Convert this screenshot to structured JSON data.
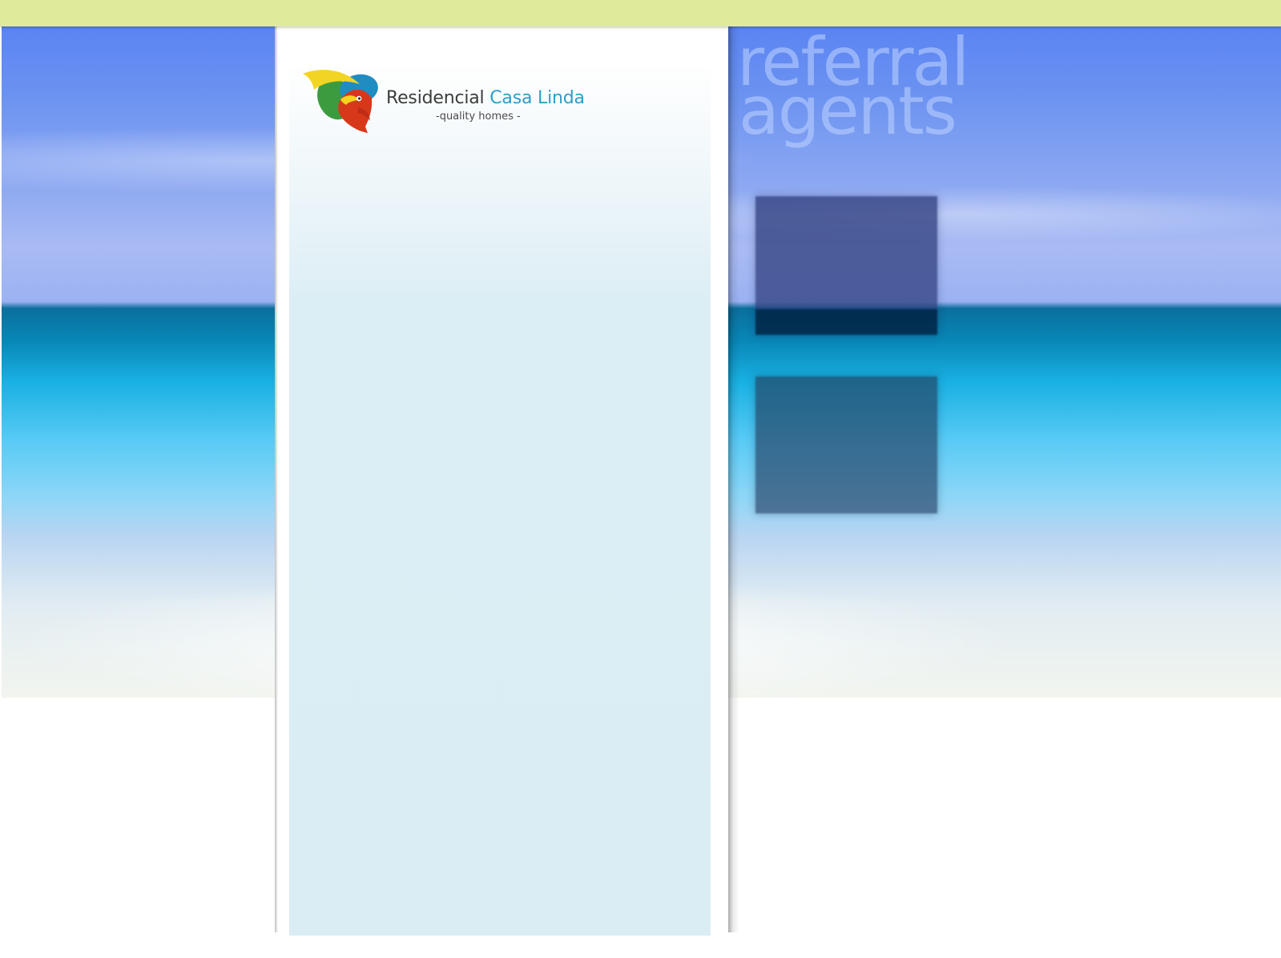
{
  "header": {
    "color": "#dfeb9a"
  },
  "logo": {
    "name_part_1": "Residencial",
    "name_part_2": "Casa Linda",
    "tagline": "-quality homes -",
    "icon": "parrot-logo-icon",
    "colors": {
      "green": "#3b9c3f",
      "blue": "#1f8dc2",
      "yellow": "#f2d524",
      "red": "#d8381a",
      "text_dark": "#3c3c3c",
      "text_blue": "#2c9ec8"
    }
  },
  "heading": {
    "line_1": "referral",
    "line_2": "agents"
  },
  "panels": [
    {
      "name": "referral-panel-1"
    },
    {
      "name": "referral-panel-2"
    }
  ],
  "theme": {
    "sky": "#5b84f2",
    "sea": "#19b1e3",
    "sand": "#f2f5ef",
    "content": "#daedf4"
  }
}
